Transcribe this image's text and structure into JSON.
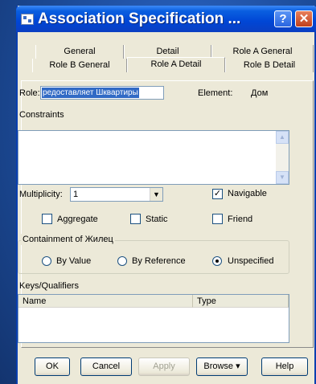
{
  "window": {
    "title": "Association Specification ..."
  },
  "titlebar": {
    "help_glyph": "?",
    "close_glyph": "✕"
  },
  "tabs_back": [
    "General",
    "Detail",
    "Role A General"
  ],
  "tabs_front": [
    "Role B General",
    "Role A Detail",
    "Role B Detail"
  ],
  "active_tab": "Role A Detail",
  "role": {
    "label": "Role:",
    "value": "редоставляет Шквартиры"
  },
  "element": {
    "label": "Element:",
    "value": "Дом"
  },
  "constraints": {
    "label": "Constraints",
    "value": ""
  },
  "multiplicity": {
    "label": "Multiplicity:",
    "value": "1"
  },
  "checkboxes": {
    "navigable": {
      "label": "Navigable",
      "checked": true
    },
    "aggregate": {
      "label": "Aggregate",
      "checked": false
    },
    "static": {
      "label": "Static",
      "checked": false
    },
    "friend": {
      "label": "Friend",
      "checked": false
    }
  },
  "containment": {
    "title": "Containment of Жилец",
    "options": [
      "By Value",
      "By Reference",
      "Unspecified"
    ],
    "selected": "Unspecified"
  },
  "keys": {
    "label": "Keys/Qualifiers",
    "columns": [
      "Name",
      "Type"
    ],
    "rows": []
  },
  "buttons": {
    "ok": "OK",
    "cancel": "Cancel",
    "apply": "Apply",
    "browse": "Browse ▾",
    "help": "Help"
  }
}
